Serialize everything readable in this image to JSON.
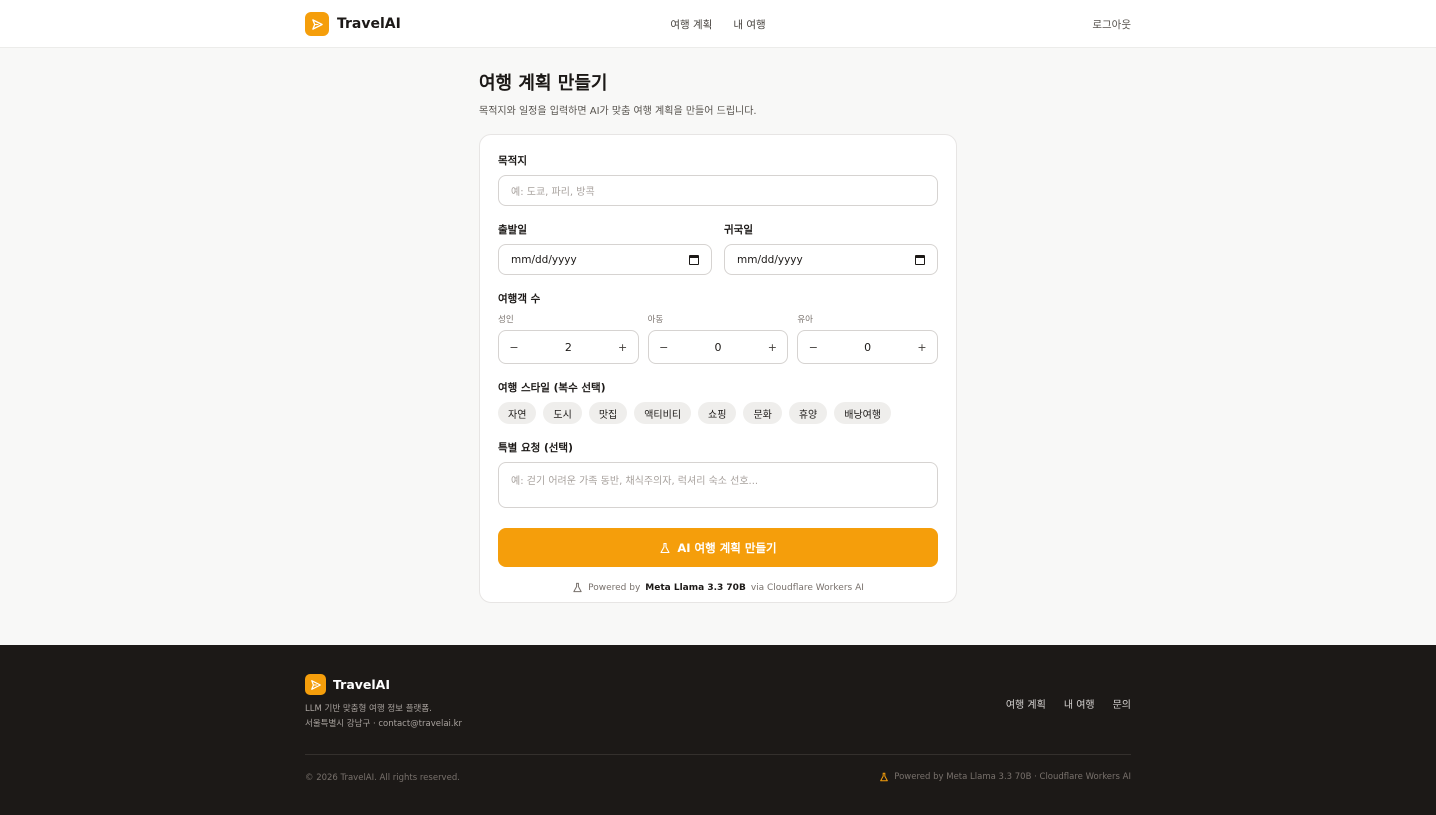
{
  "header": {
    "brand": "TravelAI",
    "nav": [
      "여행 계획",
      "내 여행"
    ],
    "logout": "로그아웃"
  },
  "page": {
    "title": "여행 계획 만들기",
    "subtitle": "목적지와 일정을 입력하면 AI가 맞춤 여행 계획을 만들어 드립니다."
  },
  "form": {
    "destination_label": "목적지",
    "destination_placeholder": "예: 도쿄, 파리, 방콕",
    "depart_label": "출발일",
    "return_label": "귀국일",
    "date_placeholder": "mm/dd/yyyy",
    "travelers_label": "여행객 수",
    "counters": [
      {
        "label": "성인",
        "value": "2"
      },
      {
        "label": "아동",
        "value": "0"
      },
      {
        "label": "유아",
        "value": "0"
      }
    ],
    "minus": "−",
    "plus": "+",
    "style_label": "여행 스타일 (복수 선택)",
    "styles": [
      "자연",
      "도시",
      "맛집",
      "액티비티",
      "쇼핑",
      "문화",
      "휴양",
      "배낭여행"
    ],
    "request_label": "특별 요청 (선택)",
    "request_placeholder": "예: 걷기 어려운 가족 동반, 채식주의자, 럭셔리 숙소 선호...",
    "submit": "AI 여행 계획 만들기",
    "powered_prefix": "Powered by",
    "powered_model": "Meta Llama 3.3 70B",
    "powered_suffix": "via Cloudflare Workers AI"
  },
  "footer": {
    "brand": "TravelAI",
    "desc1": "LLM 기반 맞춤형 여행 정보 플랫폼.",
    "desc2": "서울특별시 강남구 · contact@travelai.kr",
    "links": [
      "여행 계획",
      "내 여행",
      "문의"
    ],
    "copyright": "© 2026 TravelAI. All rights reserved.",
    "powered": "Powered by Meta Llama 3.3 70B · Cloudflare Workers AI"
  },
  "colors": {
    "accent": "#f59e0b",
    "footer_bg": "#1c1917"
  }
}
